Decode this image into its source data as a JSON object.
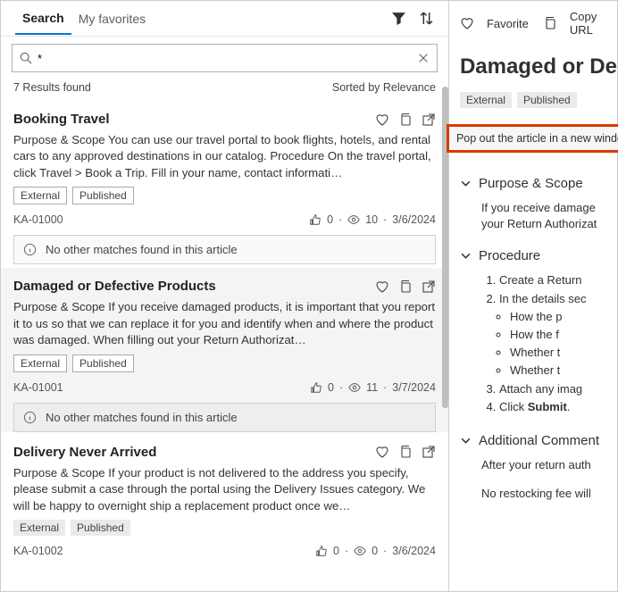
{
  "tabs": {
    "search": "Search",
    "favorites": "My favorites"
  },
  "search": {
    "query": "*",
    "results_found": "7 Results found",
    "sorted": "Sorted by Relevance",
    "no_match": "No other matches found in this article"
  },
  "results": [
    {
      "title": "Booking Travel",
      "body": "Purpose & Scope You can use our travel portal to book flights, hotels, and rental cars to any approved destinations in our catalog. Procedure On the travel portal, click Travel > Book a Trip. Fill in your name, contact informati…",
      "tags": [
        "External",
        "Published"
      ],
      "id": "KA-01000",
      "likes": "0",
      "views": "10",
      "date": "3/6/2024",
      "bordered": true,
      "selected": false
    },
    {
      "title": "Damaged or Defective Products",
      "body": "Purpose & Scope If you receive damaged products, it is important that you report it to us so that we can replace it for you and identify when and where the product was damaged. When filling out your Return Authorizat…",
      "tags": [
        "External",
        "Published"
      ],
      "id": "KA-01001",
      "likes": "0",
      "views": "11",
      "date": "3/7/2024",
      "bordered": true,
      "selected": true
    },
    {
      "title": "Delivery Never Arrived",
      "body": "Purpose & Scope If your product is not delivered to the address you specify, please submit a case through the portal using the Delivery Issues category. We will be happy to overnight ship a replacement product once we…",
      "tags": [
        "External",
        "Published"
      ],
      "id": "KA-01002",
      "likes": "0",
      "views": "0",
      "date": "3/6/2024",
      "bordered": false,
      "selected": false
    }
  ],
  "detail": {
    "favorite": "Favorite",
    "copy": "Copy URL",
    "title": "Damaged or De",
    "tags": [
      "External",
      "Published"
    ],
    "tooltip": "Pop out the article in a new window",
    "s1_h": "Purpose & Scope",
    "s1_l1": "If you receive damage",
    "s1_l2": "your Return Authorizat",
    "s2_h": "Procedure",
    "ol1": "Create a Return ",
    "ol2": "In the details sec",
    "ul1": "How the p",
    "ul2": "How the f",
    "ul3": "Whether t",
    "ul4": "Whether t",
    "ol3": "Attach any imag",
    "ol4_a": "Click ",
    "ol4_b": "Submit",
    "s3_h": "Additional Comment",
    "s3_l1": "After your return auth",
    "s3_l2": "No restocking fee will "
  }
}
